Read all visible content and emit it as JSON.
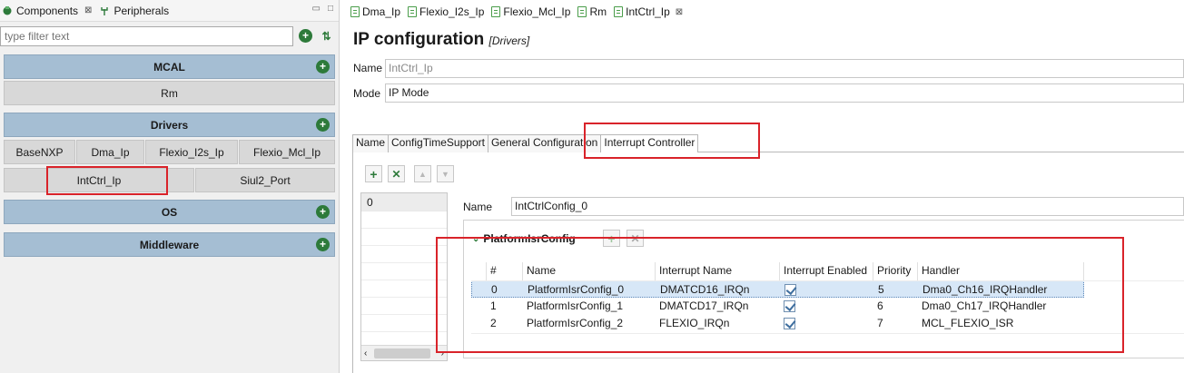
{
  "left_panel": {
    "tabs": [
      {
        "label": "Components",
        "close": "⊠"
      },
      {
        "label": "Peripherals"
      }
    ],
    "filter_placeholder": "type filter text",
    "groups": {
      "mcal": "MCAL",
      "rm": "Rm",
      "drivers": "Drivers",
      "driver_items": [
        "BaseNXP",
        "Dma_Ip",
        "Flexio_I2s_Ip",
        "Flexio_Mcl_Ip"
      ],
      "intctrl": "IntCtrl_Ip",
      "siul2": "Siul2_Port",
      "os": "OS",
      "middleware": "Middleware"
    }
  },
  "editor": {
    "tabs": [
      "Dma_Ip",
      "Flexio_I2s_Ip",
      "Flexio_Mcl_Ip",
      "Rm",
      "IntCtrl_Ip"
    ],
    "active_close": "⊠",
    "title": "IP configuration",
    "title_sub": "[Drivers]",
    "name_label": "Name",
    "name_value": "IntCtrl_Ip",
    "mode_label": "Mode",
    "mode_value": "IP Mode",
    "inner_tabs": [
      "Name",
      "ConfigTimeSupport",
      "General Configuration",
      "Interrupt Controller"
    ],
    "active_inner_tab": "Interrupt Controller",
    "list_items": [
      "0"
    ],
    "config_name_label": "Name",
    "config_name_value": "IntCtrlConfig_0",
    "section_title": "PlatformIsrConfig",
    "table": {
      "headers": [
        "#",
        "Name",
        "Interrupt Name",
        "Interrupt Enabled",
        "Priority",
        "Handler"
      ],
      "rows": [
        {
          "idx": "0",
          "name": "PlatformIsrConfig_0",
          "irq": "DMATCD16_IRQn",
          "enabled": true,
          "priority": "5",
          "handler": "Dma0_Ch16_IRQHandler"
        },
        {
          "idx": "1",
          "name": "PlatformIsrConfig_1",
          "irq": "DMATCD17_IRQn",
          "enabled": true,
          "priority": "6",
          "handler": "Dma0_Ch17_IRQHandler"
        },
        {
          "idx": "2",
          "name": "PlatformIsrConfig_2",
          "irq": "FLEXIO_IRQn",
          "enabled": true,
          "priority": "7",
          "handler": "MCL_FLEXIO_ISR"
        }
      ]
    }
  },
  "colors": {
    "group_bar": "#a5bed3",
    "highlight": "#d9232a",
    "green": "#2d7a3a",
    "selection": "#d7e7f7"
  }
}
